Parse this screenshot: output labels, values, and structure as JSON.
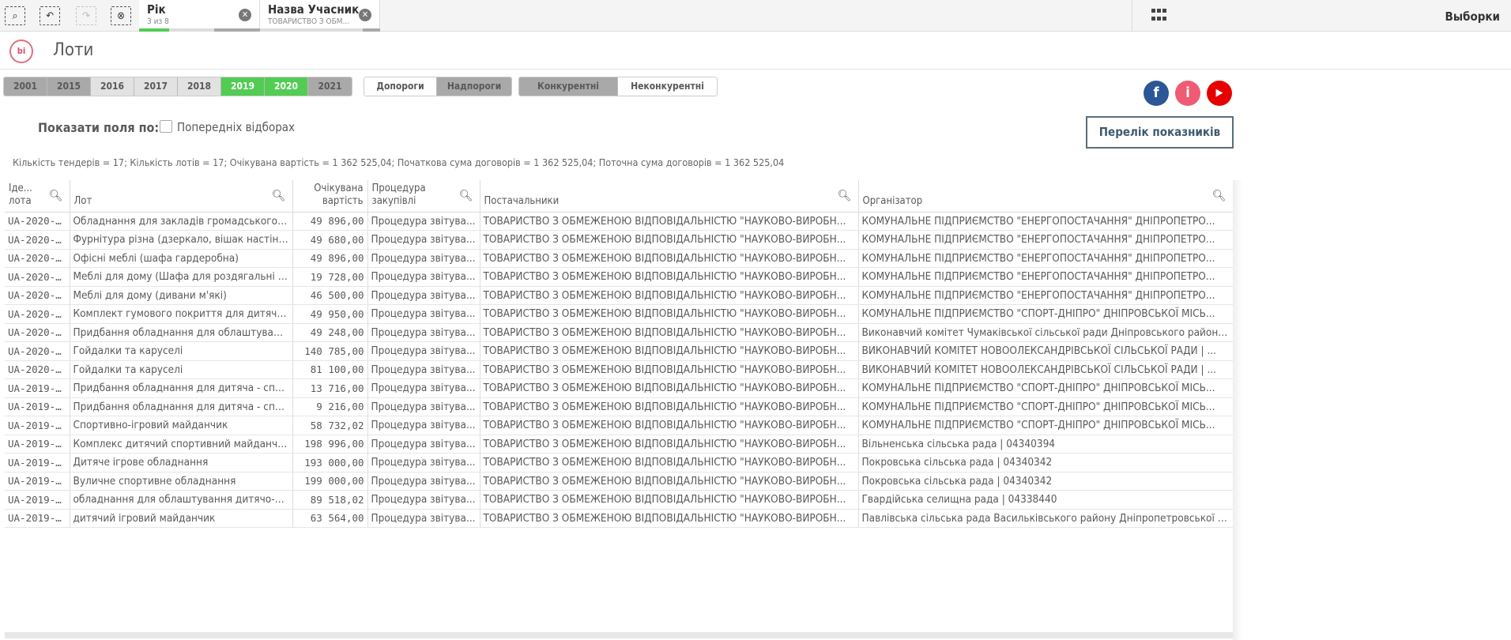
{
  "toolbar": {
    "chips": [
      {
        "title": "Рік",
        "sub": "3 из 8"
      },
      {
        "title": "Назва Учасник...",
        "sub": "ТОВАРИСТВО З ОБМ..."
      }
    ],
    "selections_label": "Выборки"
  },
  "header": {
    "logo": "bi",
    "title": "Лоти"
  },
  "years": [
    {
      "label": "2001",
      "state": "alt"
    },
    {
      "label": "2015",
      "state": "alt"
    },
    {
      "label": "2016",
      "state": "opt"
    },
    {
      "label": "2017",
      "state": "opt"
    },
    {
      "label": "2018",
      "state": "opt"
    },
    {
      "label": "2019",
      "state": "on"
    },
    {
      "label": "2020",
      "state": "on"
    },
    {
      "label": "2021",
      "state": "alt"
    }
  ],
  "thresholds": [
    "Допороги",
    "Надпороги"
  ],
  "competition": [
    "Конкурентні",
    "Неконкурентні"
  ],
  "show_fields": {
    "label": "Показати поля по:",
    "checkbox_label": "Попередніх відборах"
  },
  "list_button": "Перелік показників",
  "stats": "Кількість тендерів = 17; Кількість лотів = 17; Очікувана вартість = 1 362 525,04; Початкова сума договорів = 1 362 525,04; Поточна сума договорів = 1 362 525,04",
  "colors": {
    "selected": "#52cc52",
    "facebook": "#2b5797",
    "info": "#ef5b73",
    "youtube": "#e60000"
  },
  "table": {
    "headers": [
      "Іде... лота",
      "Лот",
      "Очікувана вартість",
      "Процедура закупівлі",
      "Постачальники",
      "Організатор"
    ],
    "rows": [
      [
        "UA-2020-...",
        "Обладнання для закладів громадського х...",
        "49 896,00",
        "Процедура звітува...",
        "ТОВАРИСТВО З ОБМЕЖЕНОЮ ВІДПОВІДАЛЬНІСТЮ \"НАУКОВО-ВИРОБН...",
        "КОМУНАЛЬНЕ ПІДПРИЄМСТВО \"ЕНЕРГОПОСТАЧАННЯ\" ДНІПРОПЕТРО..."
      ],
      [
        "UA-2020-...",
        "Фурнітура різна (дзеркало, вішак настінни...",
        "49 680,00",
        "Процедура звітува...",
        "ТОВАРИСТВО З ОБМЕЖЕНОЮ ВІДПОВІДАЛЬНІСТЮ \"НАУКОВО-ВИРОБН...",
        "КОМУНАЛЬНЕ ПІДПРИЄМСТВО \"ЕНЕРГОПОСТАЧАННЯ\" ДНІПРОПЕТРО..."
      ],
      [
        "UA-2020-...",
        "Офісні меблі (шафа гардеробна)",
        "49 896,00",
        "Процедура звітува...",
        "ТОВАРИСТВО З ОБМЕЖЕНОЮ ВІДПОВІДАЛЬНІСТЮ \"НАУКОВО-ВИРОБН...",
        "КОМУНАЛЬНЕ ПІДПРИЄМСТВО \"ЕНЕРГОПОСТАЧАННЯ\" ДНІПРОПЕТРО..."
      ],
      [
        "UA-2020-...",
        "Меблі для дому (Шафа для роздягальні 2-...",
        "19 728,00",
        "Процедура звітува...",
        "ТОВАРИСТВО З ОБМЕЖЕНОЮ ВІДПОВІДАЛЬНІСТЮ \"НАУКОВО-ВИРОБН...",
        "КОМУНАЛЬНЕ ПІДПРИЄМСТВО \"ЕНЕРГОПОСТАЧАННЯ\" ДНІПРОПЕТРО..."
      ],
      [
        "UA-2020-...",
        "Меблі для дому (дивани м'які)",
        "46 500,00",
        "Процедура звітува...",
        "ТОВАРИСТВО З ОБМЕЖЕНОЮ ВІДПОВІДАЛЬНІСТЮ \"НАУКОВО-ВИРОБН...",
        "КОМУНАЛЬНЕ ПІДПРИЄМСТВО \"ЕНЕРГОПОСТАЧАННЯ\" ДНІПРОПЕТРО..."
      ],
      [
        "UA-2020-...",
        "Комплект гумового покриття для дитячог...",
        "49 950,00",
        "Процедура звітува...",
        "ТОВАРИСТВО З ОБМЕЖЕНОЮ ВІДПОВІДАЛЬНІСТЮ \"НАУКОВО-ВИРОБН...",
        "КОМУНАЛЬНЕ ПІДПРИЄМСТВО \"СПОРТ-ДНІПРО\" ДНІПРОВСЬКОЇ МІСЬ..."
      ],
      [
        "UA-2020-...",
        "Придбання обладнання для облаштуванн...",
        "49 248,00",
        "Процедура звітува...",
        "ТОВАРИСТВО З ОБМЕЖЕНОЮ ВІДПОВІДАЛЬНІСТЮ \"НАУКОВО-ВИРОБН...",
        "Виконавчий комітет Чумаківської сільської ради Дніпровського району | 4..."
      ],
      [
        "UA-2020-...",
        "Гойдалки та каруселі",
        "140 785,00",
        "Процедура звітува...",
        "ТОВАРИСТВО З ОБМЕЖЕНОЮ ВІДПОВІДАЛЬНІСТЮ \"НАУКОВО-ВИРОБН...",
        "ВИКОНАВЧИЙ КОМІТЕТ НОВООЛЕКСАНДРІВСЬКОЇ СІЛЬСЬКОЇ РАДИ | ..."
      ],
      [
        "UA-2020-...",
        "Гойдалки та каруселі",
        "81 100,00",
        "Процедура звітува...",
        "ТОВАРИСТВО З ОБМЕЖЕНОЮ ВІДПОВІДАЛЬНІСТЮ \"НАУКОВО-ВИРОБН...",
        "ВИКОНАВЧИЙ КОМІТЕТ НОВООЛЕКСАНДРІВСЬКОЇ СІЛЬСЬКОЇ РАДИ | ..."
      ],
      [
        "UA-2019-...",
        "Придбання обладнання для дитяча - спор...",
        "13 716,00",
        "Процедура звітува...",
        "ТОВАРИСТВО З ОБМЕЖЕНОЮ ВІДПОВІДАЛЬНІСТЮ \"НАУКОВО-ВИРОБН...",
        "КОМУНАЛЬНЕ ПІДПРИЄМСТВО \"СПОРТ-ДНІПРО\" ДНІПРОВСЬКОЇ МІСЬ..."
      ],
      [
        "UA-2019-...",
        "Придбання обладнання для дитяча - спор...",
        "9 216,00",
        "Процедура звітува...",
        "ТОВАРИСТВО З ОБМЕЖЕНОЮ ВІДПОВІДАЛЬНІСТЮ \"НАУКОВО-ВИРОБН...",
        "КОМУНАЛЬНЕ ПІДПРИЄМСТВО \"СПОРТ-ДНІПРО\" ДНІПРОВСЬКОЇ МІСЬ..."
      ],
      [
        "UA-2019-...",
        "Спортивно-ігровий майданчик",
        "58 732,02",
        "Процедура звітува...",
        "ТОВАРИСТВО З ОБМЕЖЕНОЮ ВІДПОВІДАЛЬНІСТЮ \"НАУКОВО-ВИРОБН...",
        "КОМУНАЛЬНЕ ПІДПРИЄМСТВО \"СПОРТ-ДНІПРО\" ДНІПРОВСЬКОЇ МІСЬ..."
      ],
      [
        "UA-2019-...",
        "Комплекс дитячий спортивний майданчик",
        "198 996,00",
        "Процедура звітува...",
        "ТОВАРИСТВО З ОБМЕЖЕНОЮ ВІДПОВІДАЛЬНІСТЮ \"НАУКОВО-ВИРОБН...",
        "Вільненська сільська рада | 04340394"
      ],
      [
        "UA-2019-...",
        "Дитяче ігрове обладнання",
        "193 000,00",
        "Процедура звітува...",
        "ТОВАРИСТВО З ОБМЕЖЕНОЮ ВІДПОВІДАЛЬНІСТЮ \"НАУКОВО-ВИРОБН...",
        "Покровська сільська рада | 04340342"
      ],
      [
        "UA-2019-...",
        "Вуличне спортивне обладнання",
        "199 000,00",
        "Процедура звітува...",
        "ТОВАРИСТВО З ОБМЕЖЕНОЮ ВІДПОВІДАЛЬНІСТЮ \"НАУКОВО-ВИРОБН...",
        "Покровська сільська рада | 04340342"
      ],
      [
        "UA-2019-...",
        "обладнання для облаштування дитячо-сп...",
        "89 518,02",
        "Процедура звітува...",
        "ТОВАРИСТВО З ОБМЕЖЕНОЮ ВІДПОВІДАЛЬНІСТЮ \"НАУКОВО-ВИРОБН...",
        "Гвардійська селищна рада | 04338440"
      ],
      [
        "UA-2019-...",
        "дитячий ігровий майданчик",
        "63 564,00",
        "Процедура звітува...",
        "ТОВАРИСТВО З ОБМЕЖЕНОЮ ВІДПОВІДАЛЬНІСТЮ \"НАУКОВО-ВИРОБН...",
        "Павлівська сільська рада Васильківського району Дніпропетровської обл..."
      ]
    ]
  }
}
